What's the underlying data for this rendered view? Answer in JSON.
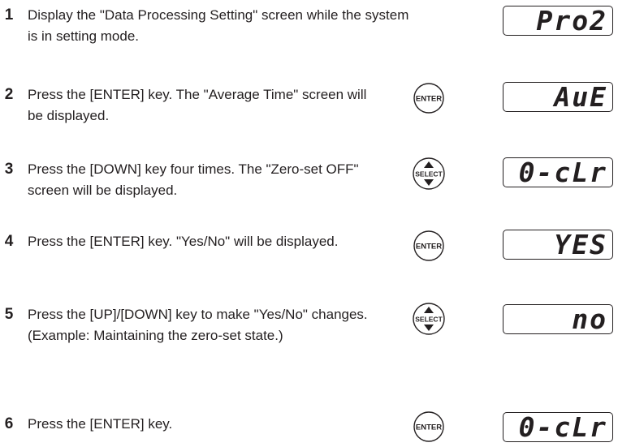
{
  "steps": [
    {
      "num": "1",
      "text": "Display the \"Data Processing Setting\" screen while the system is in setting mode.",
      "key": "",
      "display": "Pro2"
    },
    {
      "num": "2",
      "text": "Press the [ENTER] key. The \"Average Time\" screen will be displayed.",
      "key": "ENTER",
      "display": "AuE"
    },
    {
      "num": "3",
      "text": "Press the [DOWN] key four times. The \"Zero-set OFF\" screen will be displayed.",
      "key": "SELECT",
      "display": "0-cLr"
    },
    {
      "num": "4",
      "text": "Press the [ENTER] key. \"Yes/No\" will be displayed.",
      "key": "ENTER",
      "display": "YES"
    },
    {
      "num": "5",
      "text": "Press the [UP]/[DOWN] key to make \"Yes/No\" changes. (Example: Maintaining the zero-set state.)",
      "key": "SELECT",
      "display": "no"
    },
    {
      "num": "6",
      "text": "Press the [ENTER] key.",
      "key": "ENTER",
      "display": "0-cLr"
    }
  ]
}
